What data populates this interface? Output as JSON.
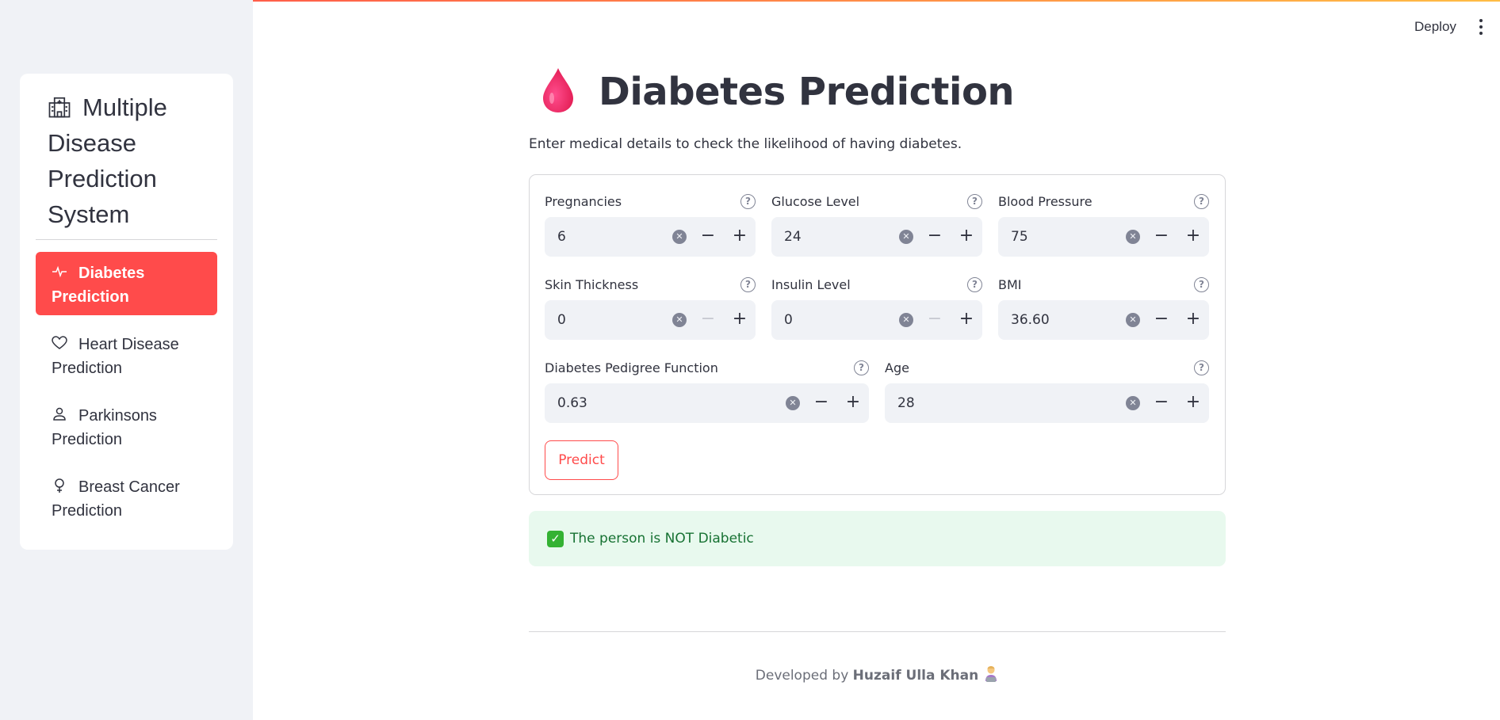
{
  "sidebar": {
    "title": "Multiple Disease Prediction System",
    "title_icon": "hospital-icon",
    "items": [
      {
        "label": "Diabetes Prediction",
        "icon": "activity-icon",
        "active": true
      },
      {
        "label": "Heart Disease Prediction",
        "icon": "heart-icon",
        "active": false
      },
      {
        "label": "Parkinsons Prediction",
        "icon": "person-icon",
        "active": false
      },
      {
        "label": "Breast Cancer Prediction",
        "icon": "female-icon",
        "active": false
      }
    ]
  },
  "header": {
    "deploy_label": "Deploy",
    "menu_icon": "kebab-menu-icon"
  },
  "main": {
    "title": "Diabetes Prediction",
    "title_icon": "drop-of-blood-icon",
    "subtitle": "Enter medical details to check the likelihood of having diabetes.",
    "fields": [
      {
        "label": "Pregnancies",
        "value": "6",
        "minus_disabled": false
      },
      {
        "label": "Glucose Level",
        "value": "24",
        "minus_disabled": false
      },
      {
        "label": "Blood Pressure",
        "value": "75",
        "minus_disabled": false
      },
      {
        "label": "Skin Thickness",
        "value": "0",
        "minus_disabled": true
      },
      {
        "label": "Insulin Level",
        "value": "0",
        "minus_disabled": true
      },
      {
        "label": "BMI",
        "value": "36.60",
        "minus_disabled": false
      },
      {
        "label": "Diabetes Pedigree Function",
        "value": "0.63",
        "minus_disabled": false
      },
      {
        "label": "Age",
        "value": "28",
        "minus_disabled": false
      }
    ],
    "help_glyph": "?",
    "clear_glyph": "✕",
    "minus_glyph": "−",
    "plus_glyph": "+",
    "predict_label": "Predict",
    "result": {
      "icon": "check-mark-icon",
      "check_glyph": "✓",
      "text": "The person is NOT Diabetic"
    }
  },
  "footer": {
    "prefix": "Developed by ",
    "author": "Huzaif Ulla Khan",
    "emoji_icon": "technologist-emoji-icon"
  },
  "colors": {
    "accent": "#ff4b4b",
    "sidebar_bg": "#f0f2f6",
    "success_bg": "#e8f9ee",
    "success_text": "#177233"
  }
}
